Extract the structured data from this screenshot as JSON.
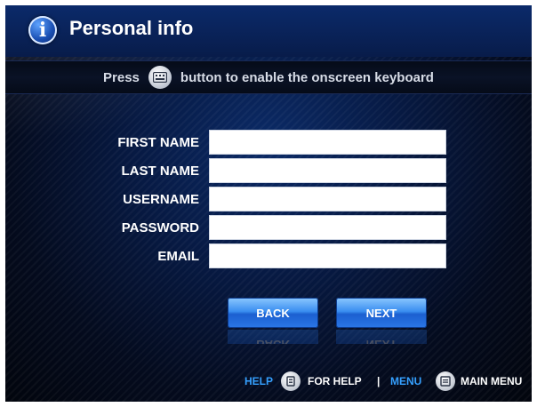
{
  "header": {
    "title": "Personal info",
    "icon": "info-icon"
  },
  "hint": {
    "prefix": "Press",
    "suffix": "button to enable the onscreen keyboard",
    "icon": "keyboard-icon"
  },
  "form": {
    "fields": [
      {
        "label": "FIRST NAME",
        "value": ""
      },
      {
        "label": "LAST NAME",
        "value": ""
      },
      {
        "label": "USERNAME",
        "value": ""
      },
      {
        "label": "PASSWORD",
        "value": ""
      },
      {
        "label": "EMAIL",
        "value": ""
      }
    ]
  },
  "buttons": {
    "back": "BACK",
    "next": "NEXT"
  },
  "footer": {
    "help_key": "HELP",
    "help_text": "FOR HELP",
    "separator": "|",
    "menu_key": "MENU",
    "menu_text": "MAIN MENU"
  },
  "colors": {
    "accent": "#35a0ff",
    "background": "#071a44",
    "button": "#2b77e6"
  }
}
